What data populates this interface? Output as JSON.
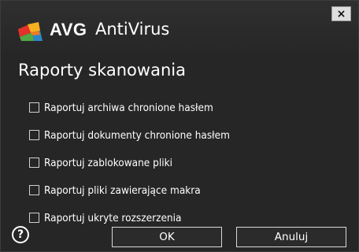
{
  "window": {
    "brand": "AVG",
    "product": "AntiVirus",
    "close_label": "×"
  },
  "section": {
    "title": "Raporty skanowania"
  },
  "options": [
    {
      "label": "Raportuj archiwa chronione hasłem",
      "checked": false
    },
    {
      "label": "Raportuj dokumenty chronione hasłem",
      "checked": false
    },
    {
      "label": "Raportuj zablokowane pliki",
      "checked": false
    },
    {
      "label": "Raportuj pliki zawierające makra",
      "checked": false
    },
    {
      "label": "Raportuj ukryte rozszerzenia",
      "checked": false
    }
  ],
  "footer": {
    "help_icon": "question-circle-icon",
    "help_glyph": "?",
    "ok_label": "OK",
    "cancel_label": "Anuluj"
  },
  "colors": {
    "background": "#262626",
    "logo_red": "#e4312b",
    "logo_yellow": "#f5b120",
    "logo_green": "#52a846",
    "logo_blue": "#2d87c8"
  }
}
